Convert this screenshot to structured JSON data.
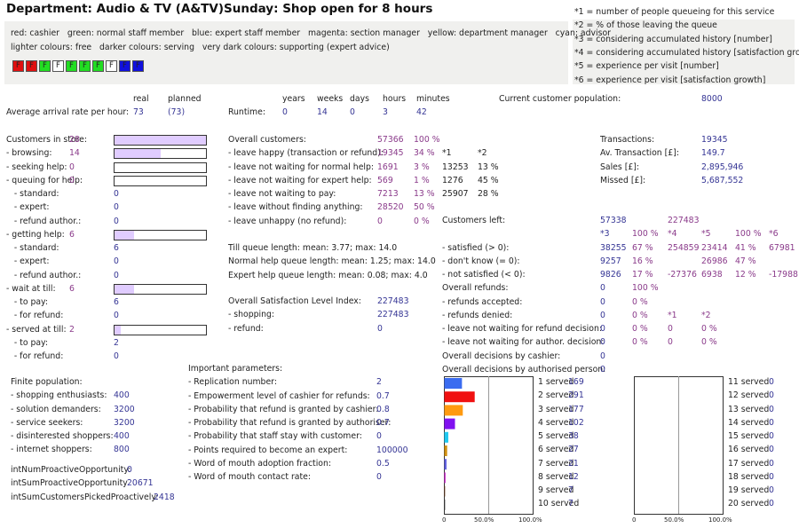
{
  "header": {
    "department": "Department: Audio & TV (A&TV)",
    "day": "Sunday: Shop open for 8 hours"
  },
  "legend": {
    "line1": "red: cashier   green: normal staff member   blue: expert staff member   magenta: section manager   yellow: department manager   cyan: advisor",
    "line2": "lighter colours: free   darker colours: serving   very dark colours: supporting (expert advice)"
  },
  "staff": [
    {
      "label": "F",
      "color": "#e01010"
    },
    {
      "label": "F",
      "color": "#e01010"
    },
    {
      "label": "F",
      "color": "#22dd22"
    },
    {
      "label": "F",
      "color": "#ffffff"
    },
    {
      "label": "F",
      "color": "#22dd22"
    },
    {
      "label": "F",
      "color": "#22dd22"
    },
    {
      "label": "F",
      "color": "#22dd22"
    },
    {
      "label": "F",
      "color": "#ffffff"
    },
    {
      "label": "F",
      "color": "#1010dd"
    },
    {
      "label": "F",
      "color": "#1010dd"
    }
  ],
  "notes": [
    "*1 = number of people queueing for this service",
    "*2 = % of those leaving the queue",
    "*3 = considering accumulated history [number]",
    "*4 = considering accumulated history [satisfaction growth]",
    "*5 = experience per visit [number]",
    "*6 = experience per visit [satisfaction growth]"
  ],
  "arrival": {
    "rows": [
      [
        "",
        "real",
        "planned",
        "",
        "years",
        "weeks",
        "days",
        "hours",
        "minutes",
        "",
        "Current customer population:",
        ""
      ],
      [
        "Average arrival rate per hour:",
        "73",
        "(73)",
        "Runtime:",
        "0",
        "14",
        "0",
        "3",
        "42",
        "",
        "",
        ""
      ],
      [
        "",
        "",
        "",
        "",
        "",
        "",
        "",
        "",
        "",
        "",
        "",
        "8000"
      ]
    ]
  },
  "store": {
    "rows": [
      [
        "Customers in store:",
        "28",
        ""
      ],
      [
        "- browsing:",
        "14",
        ""
      ],
      [
        "- seeking help:",
        "0",
        ""
      ],
      [
        "- queuing for help:",
        "0",
        ""
      ],
      [
        "   - standard:",
        "",
        "0"
      ],
      [
        "   - expert:",
        "",
        "0"
      ],
      [
        "   - refund author.:",
        "",
        "0"
      ],
      [
        "- getting help:",
        "6",
        ""
      ],
      [
        "   - standard:",
        "",
        "6"
      ],
      [
        "   - expert:",
        "",
        "0"
      ],
      [
        "   - refund author.:",
        "",
        "0"
      ],
      [
        "- wait at till:",
        "6",
        ""
      ],
      [
        "   - to pay:",
        "",
        "6"
      ],
      [
        "   - for refund:",
        "",
        "0"
      ],
      [
        "- served at till:",
        "2",
        ""
      ],
      [
        "   - to pay:",
        "",
        "2"
      ],
      [
        "   - for refund:",
        "",
        "0"
      ]
    ],
    "bars": [
      {
        "row": 0,
        "fill_pct": 100
      },
      {
        "row": 1,
        "fill_pct": 50
      },
      {
        "row": 2,
        "fill_pct": 0
      },
      {
        "row": 3,
        "fill_pct": 0
      },
      {
        "row": 7,
        "fill_pct": 21
      },
      {
        "row": 11,
        "fill_pct": 21
      },
      {
        "row": 14,
        "fill_pct": 7
      }
    ]
  },
  "overall": {
    "rows": [
      [
        "Overall customers:",
        "57366",
        "100 %",
        "",
        ""
      ],
      [
        "- leave happy (transaction or refund):",
        "19345",
        "34 %",
        "*1",
        "*2"
      ],
      [
        "- leave not waiting for normal help:",
        "1691",
        "3 %",
        "13253",
        "13 %"
      ],
      [
        "- leave not waiting for expert help:",
        "569",
        "1 %",
        "1276",
        "45 %"
      ],
      [
        "- leave not waiting to pay:",
        "7213",
        "13 %",
        "25907",
        "28 %"
      ],
      [
        "- leave without finding anything:",
        "28520",
        "50 %",
        "",
        ""
      ],
      [
        "- leave unhappy (no refund):",
        "0",
        "0 %",
        "",
        ""
      ]
    ]
  },
  "queues": {
    "rows": [
      [
        "Till queue length: mean: 3.77; max: 14.0"
      ],
      [
        "Normal help queue length: mean: 1.25; max: 14.0"
      ],
      [
        "Expert help queue length: mean: 0.08; max: 4.0"
      ]
    ]
  },
  "satisfaction": {
    "rows": [
      [
        "Overall Satisfaction Level Index:",
        "227483"
      ],
      [
        "- shopping:",
        "227483"
      ],
      [
        "- refund:",
        "0"
      ]
    ]
  },
  "sales": {
    "rows": [
      [
        "Transactions:",
        "19345"
      ],
      [
        "Av. Transaction [£]:",
        "149.7"
      ],
      [
        "Sales [£]:",
        "2,895,946"
      ],
      [
        "Missed [£]:",
        "5,687,552"
      ]
    ]
  },
  "left": {
    "rows": [
      [
        "Customers left:",
        "57338",
        "",
        "227483",
        "",
        "",
        ""
      ],
      [
        "",
        "*3",
        "100 %",
        "*4",
        "*5",
        "100 %",
        "*6"
      ],
      [
        "- satisfied (> 0):",
        "38255",
        "67 %",
        "254859",
        "23414",
        "41 %",
        "67981"
      ],
      [
        "- don't know (= 0):",
        "9257",
        "16 %",
        "",
        "26986",
        "47 %",
        ""
      ],
      [
        "- not satisfied (< 0):",
        "9826",
        "17 %",
        "-27376",
        "6938",
        "12 %",
        "-17988"
      ],
      [
        "Overall refunds:",
        "0",
        "100 %",
        "",
        "",
        "",
        ""
      ],
      [
        "- refunds accepted:",
        "0",
        "0 %",
        "",
        "",
        "",
        ""
      ],
      [
        "- refunds denied:",
        "0",
        "0 %",
        "*1",
        "*2",
        "",
        ""
      ],
      [
        "- leave not waiting for refund decision:",
        "0",
        "0 %",
        "0",
        "0 %",
        "",
        ""
      ],
      [
        "- leave not waiting for author. decision:",
        "0",
        "0 %",
        "0",
        "0 %",
        "",
        ""
      ],
      [
        "Overall decisions by cashier:",
        "0",
        "",
        "",
        "",
        "",
        ""
      ],
      [
        "Overall decisions by authorised person:",
        "0",
        "",
        "",
        "",
        "",
        ""
      ]
    ]
  },
  "population": {
    "rows": [
      [
        "Finite population:",
        ""
      ],
      [
        "- shopping enthusiasts:",
        "400"
      ],
      [
        "- solution demanders:",
        "3200"
      ],
      [
        "- service seekers:",
        "3200"
      ],
      [
        "- disinterested shoppers:",
        "400"
      ],
      [
        "- internet shoppers:",
        "800"
      ]
    ]
  },
  "proactive": {
    "rows": [
      [
        "intNumProactiveOpportunity:",
        "0"
      ],
      [
        "intSumProactiveOpportunity",
        "20671"
      ],
      [
        "intSumCustomersPickedProactively:",
        "2418"
      ]
    ]
  },
  "params": {
    "rows": [
      [
        "Important parameters:",
        ""
      ],
      [
        "- Replication number:",
        "2"
      ],
      [
        "- Empowerment level of cashier for refunds:",
        "0.7"
      ],
      [
        "- Probability that refund is granted by cashier:",
        "0.8"
      ],
      [
        "- Probability that refund is granted by authoriser:",
        "0.7"
      ],
      [
        "- Probability that staff stay with customer:",
        "0"
      ],
      [
        "- Points required to become an expert:",
        "100000"
      ],
      [
        "- Word of mouth adoption fraction:",
        "0.5"
      ],
      [
        "- Word of mouth contact rate:",
        "0"
      ]
    ]
  },
  "chart_data": [
    {
      "type": "bar",
      "orientation": "horizontal",
      "categories": [
        "1 served",
        "2 served",
        "3 served",
        "4 served",
        "5 served",
        "6 served",
        "7 served",
        "8 served",
        "9 served",
        "10 served"
      ],
      "values": [
        169,
        291,
        177,
        102,
        38,
        27,
        21,
        12,
        7,
        7
      ],
      "colors": [
        "#3b6cf0",
        "#f01010",
        "#ff9a10",
        "#8010f0",
        "#20c8f0",
        "#d09010",
        "#6060e0",
        "#d030d0",
        "#603010",
        "#303030"
      ],
      "xticks": [
        "0",
        "50.0%",
        "100.0%"
      ],
      "xlim": [
        0,
        100
      ],
      "grid": true
    },
    {
      "type": "bar",
      "orientation": "horizontal",
      "categories": [
        "11 served",
        "12 served",
        "13 served",
        "14 served",
        "15 served",
        "16 served",
        "17 served",
        "18 served",
        "19 served",
        "20 served"
      ],
      "values": [
        0,
        0,
        0,
        0,
        0,
        0,
        0,
        0,
        0,
        0
      ],
      "colors": [],
      "xticks": [
        "0",
        "50.0%",
        "100.0%"
      ],
      "xlim": [
        0,
        100
      ],
      "grid": true
    }
  ]
}
